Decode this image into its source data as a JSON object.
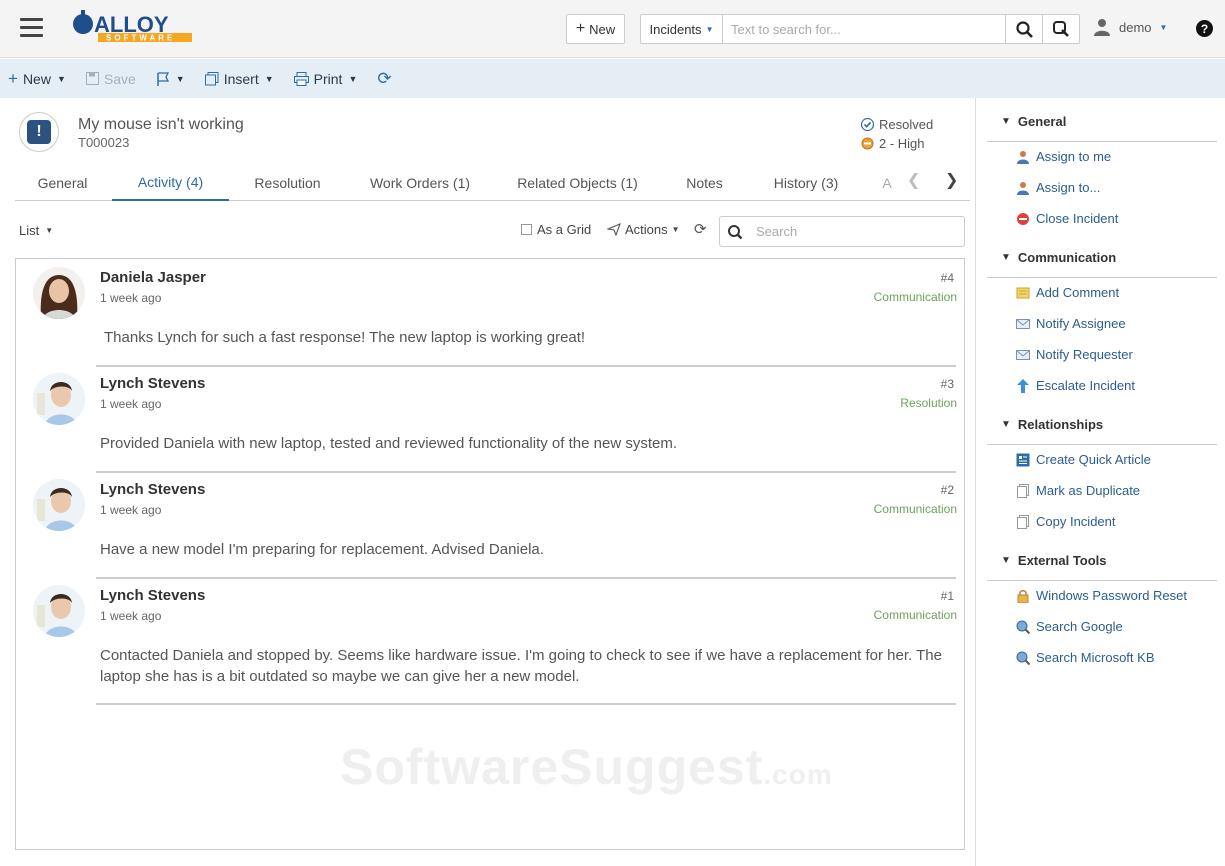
{
  "topbar": {
    "new_label": "New",
    "search_scope": "Incidents",
    "search_placeholder": "Text to search for...",
    "user": "demo",
    "help": "?"
  },
  "toolbar": {
    "new_label": "New",
    "save_label": "Save",
    "insert_label": "Insert",
    "print_label": "Print"
  },
  "incident": {
    "title": "My mouse isn't working",
    "number": "T000023",
    "status": "Resolved",
    "priority": "2 - High"
  },
  "tabs": [
    "General",
    "Activity (4)",
    "Resolution",
    "Work Orders (1)",
    "Related Objects (1)",
    "Notes",
    "History (3)",
    "A"
  ],
  "activity_controls": {
    "view": "List",
    "grid_label": "As a Grid",
    "actions_label": "Actions",
    "search_placeholder": "Search"
  },
  "entries": [
    {
      "name": "Daniela Jasper",
      "time": "1 week ago",
      "num": "#4",
      "kind": "Communication",
      "msg": "Thanks Lynch for such a fast response! The new laptop is working great!"
    },
    {
      "name": "Lynch Stevens",
      "time": "1 week ago",
      "num": "#3",
      "kind": "Resolution",
      "msg": "Provided Daniela with new laptop, tested and reviewed functionality of the new system."
    },
    {
      "name": "Lynch Stevens",
      "time": "1 week ago",
      "num": "#2",
      "kind": "Communication",
      "msg": "Have a new model I'm preparing for replacement. Advised Daniela."
    },
    {
      "name": "Lynch Stevens",
      "time": "1 week ago",
      "num": "#1",
      "kind": "Communication",
      "msg": "Contacted Daniela and stopped by. Seems like hardware issue. I'm going to check to see if we have a replacement for her. The laptop she has is a bit outdated so maybe we can give her a new model."
    }
  ],
  "watermark": {
    "main": "SoftwareSuggest",
    "suffix": ".com"
  },
  "right_panel": {
    "general": {
      "title": "General",
      "items": [
        "Assign to me",
        "Assign to...",
        "Close Incident"
      ]
    },
    "communication": {
      "title": "Communication",
      "items": [
        "Add Comment",
        "Notify Assignee",
        "Notify Requester",
        "Escalate Incident"
      ]
    },
    "relationships": {
      "title": "Relationships",
      "items": [
        "Create Quick Article",
        "Mark as Duplicate",
        "Copy Incident"
      ]
    },
    "external": {
      "title": "External Tools",
      "items": [
        "Windows Password Reset",
        "Search Google",
        "Search Microsoft KB"
      ]
    }
  },
  "colors": {
    "accent": "#2e6da4",
    "toolbar_bg": "#e6eef5",
    "kind_green": "#6aa35b",
    "logo_blue": "#1f4e8c",
    "logo_orange": "#f5a623"
  }
}
